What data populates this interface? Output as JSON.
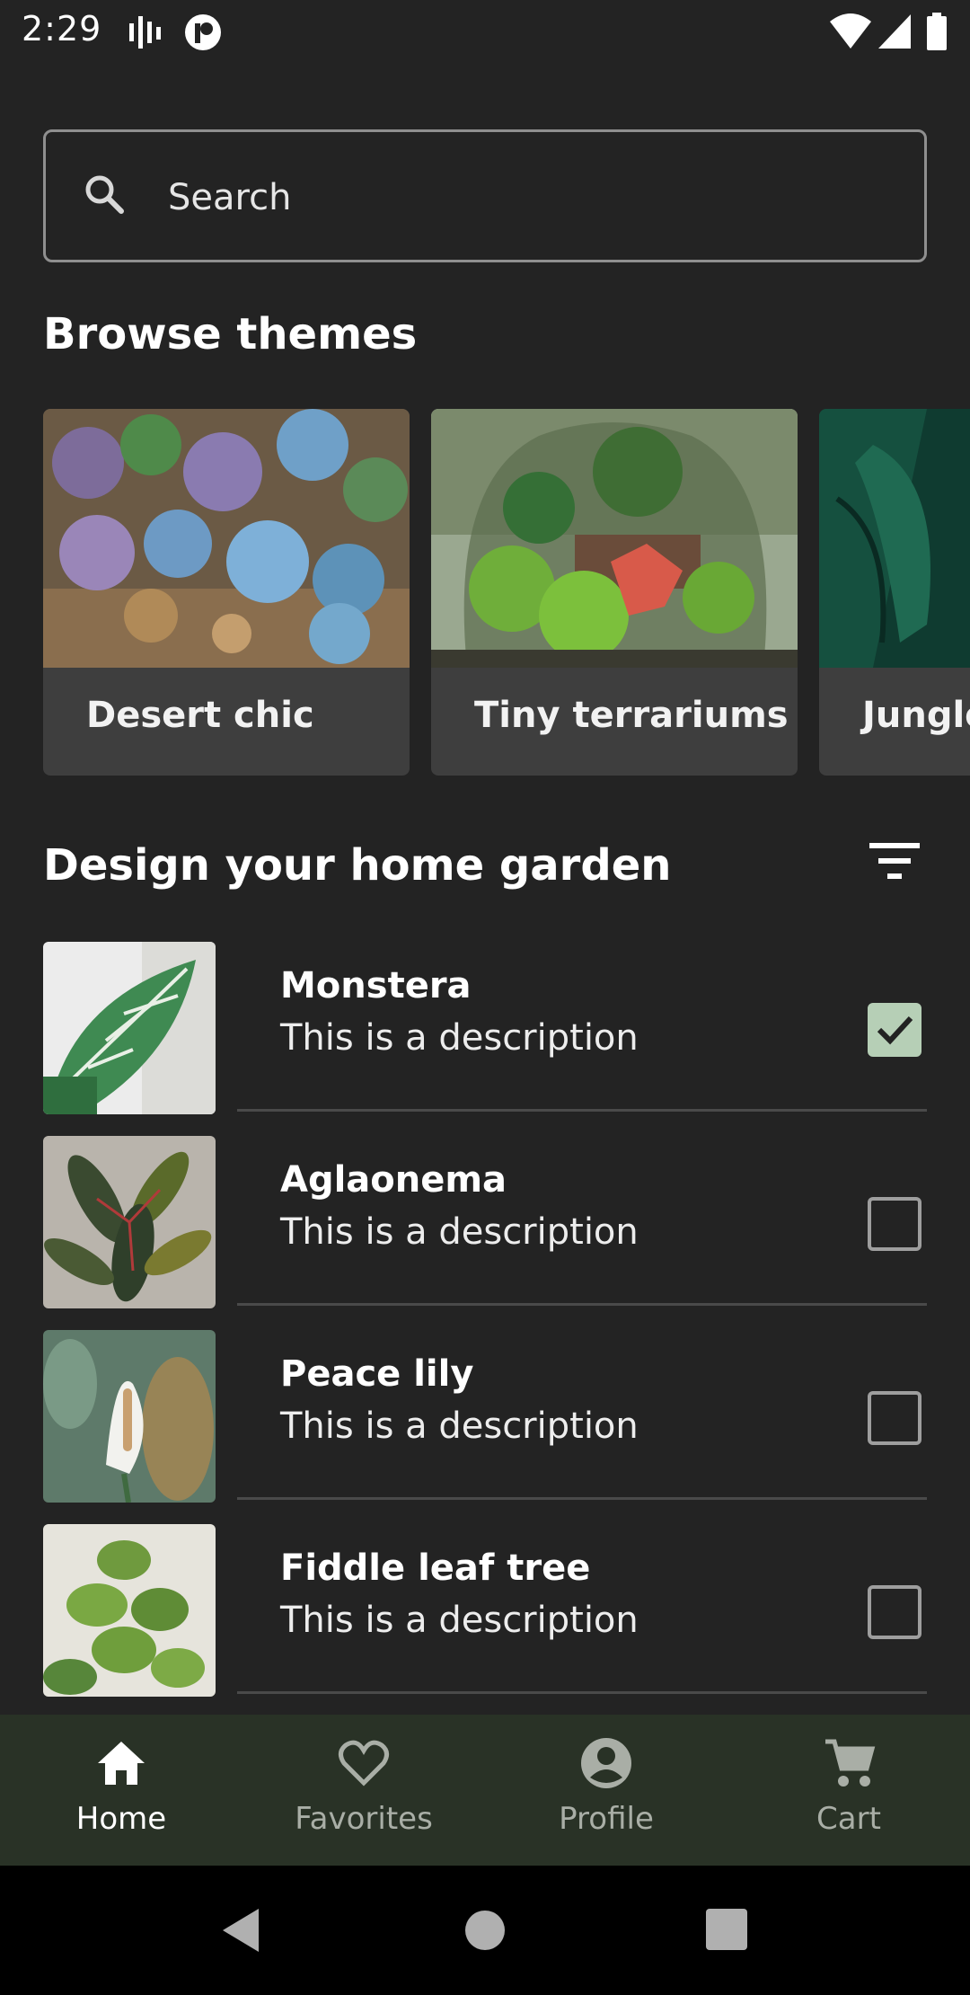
{
  "status_bar": {
    "time": "2:29",
    "icons": [
      "signal-bars-icon",
      "app-notification-icon",
      "wifi-icon",
      "cell-signal-icon",
      "battery-icon"
    ]
  },
  "search": {
    "placeholder": "Search",
    "value": ""
  },
  "browse": {
    "title": "Browse themes",
    "themes": [
      {
        "label": "Desert chic",
        "image": "succulents-photo"
      },
      {
        "label": "Tiny terrariums",
        "image": "terrarium-photo"
      },
      {
        "label": "Jungle",
        "image": "monstera-leaves-photo"
      }
    ]
  },
  "design": {
    "title": "Design your home garden",
    "filter_icon": "filter-list-icon",
    "plants": [
      {
        "name": "Monstera",
        "description": "This is a description",
        "checked": true
      },
      {
        "name": "Aglaonema",
        "description": "This is a description",
        "checked": false
      },
      {
        "name": "Peace lily",
        "description": "This is a description",
        "checked": false
      },
      {
        "name": "Fiddle leaf tree",
        "description": "This is a description",
        "checked": false
      }
    ]
  },
  "bottom_nav": {
    "items": [
      {
        "label": "Home",
        "icon": "home-icon",
        "active": true
      },
      {
        "label": "Favorites",
        "icon": "heart-outline-icon",
        "active": false
      },
      {
        "label": "Profile",
        "icon": "account-circle-icon",
        "active": false
      },
      {
        "label": "Cart",
        "icon": "shopping-cart-icon",
        "active": false
      }
    ]
  },
  "colors": {
    "background": "#232323",
    "card": "#3e3e3e",
    "bottom_nav": "#293226",
    "checkbox_checked": "#b6cfb6"
  }
}
